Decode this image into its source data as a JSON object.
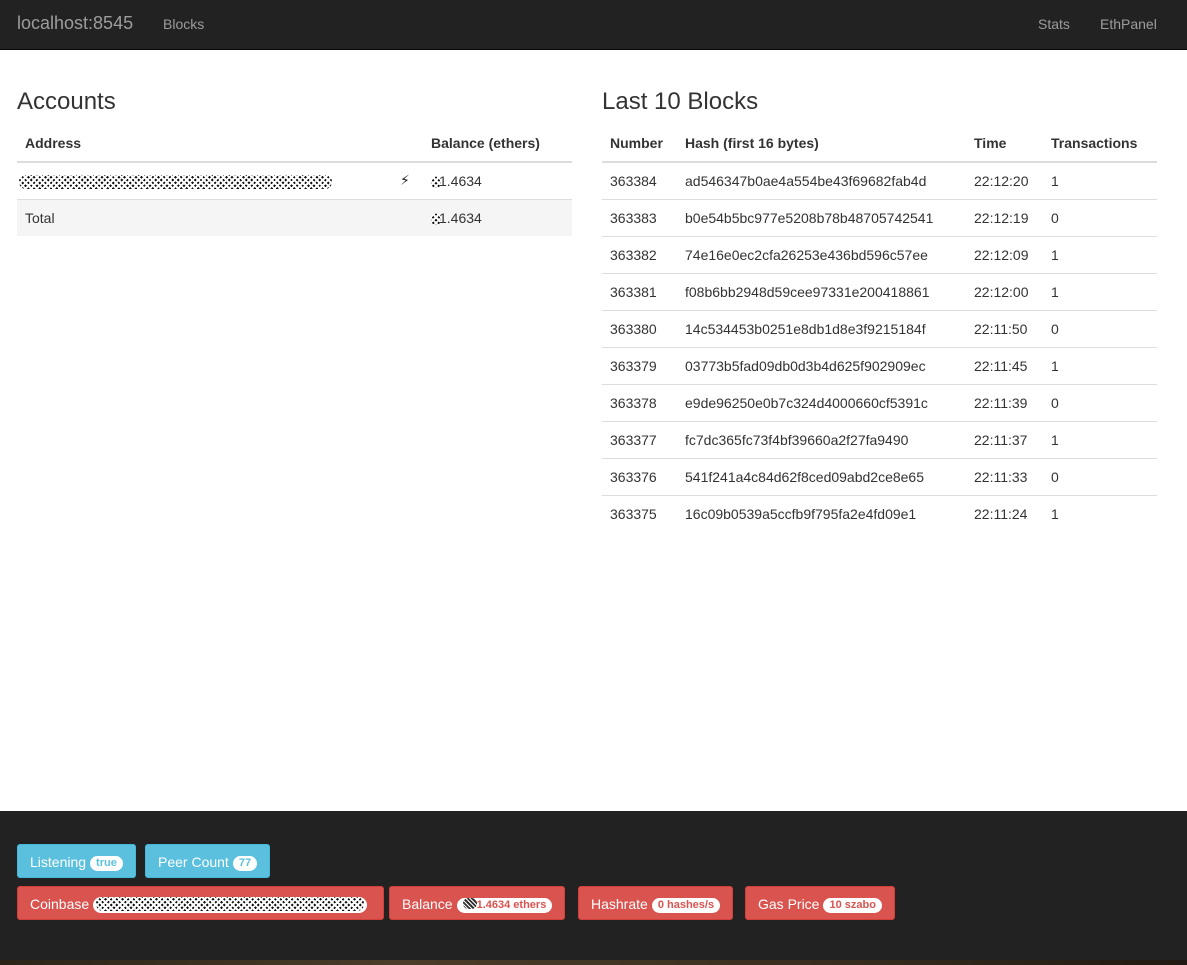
{
  "navbar": {
    "brand": "localhost:8545",
    "links": {
      "blocks": "Blocks",
      "stats": "Stats",
      "ethpanel": "EthPanel"
    }
  },
  "accounts": {
    "title": "Accounts",
    "headers": {
      "address": "Address",
      "balance": "Balance (ethers)"
    },
    "rows": [
      {
        "address": "[redacted]",
        "icon": "bolt-icon",
        "balance": "1.4634"
      }
    ],
    "total": {
      "label": "Total",
      "balance": "1.4634"
    }
  },
  "blocks": {
    "title": "Last 10 Blocks",
    "headers": {
      "number": "Number",
      "hash": "Hash (first 16 bytes)",
      "time": "Time",
      "transactions": "Transactions"
    },
    "rows": [
      {
        "number": "363384",
        "hash": "ad546347b0ae4a554be43f69682fab4d",
        "time": "22:12:20",
        "transactions": "1"
      },
      {
        "number": "363383",
        "hash": "b0e54b5bc977e5208b78b48705742541",
        "time": "22:12:19",
        "transactions": "0"
      },
      {
        "number": "363382",
        "hash": "74e16e0ec2cfa26253e436bd596c57ee",
        "time": "22:12:09",
        "transactions": "1"
      },
      {
        "number": "363381",
        "hash": "f08b6bb2948d59cee97331e200418861",
        "time": "22:12:00",
        "transactions": "1"
      },
      {
        "number": "363380",
        "hash": "14c534453b0251e8db1d8e3f9215184f",
        "time": "22:11:50",
        "transactions": "0"
      },
      {
        "number": "363379",
        "hash": "03773b5fad09db0d3b4d625f902909ec",
        "time": "22:11:45",
        "transactions": "1"
      },
      {
        "number": "363378",
        "hash": "e9de96250e0b7c324d4000660cf5391c",
        "time": "22:11:39",
        "transactions": "0"
      },
      {
        "number": "363377",
        "hash": "fc7dc365fc73f4bf39660a2f27fa9490",
        "time": "22:11:37",
        "transactions": "1"
      },
      {
        "number": "363376",
        "hash": "541f241a4c84d62f8ced09abd2ce8e65",
        "time": "22:11:33",
        "transactions": "0"
      },
      {
        "number": "363375",
        "hash": "16c09b0539a5ccfb9f795fa2e4fd09e1",
        "time": "22:11:24",
        "transactions": "1"
      }
    ]
  },
  "status": {
    "listening": {
      "label": "Listening",
      "value": "true"
    },
    "peer_count": {
      "label": "Peer Count",
      "value": "77"
    },
    "coinbase": {
      "label": "Coinbase",
      "value": "[redacted]"
    },
    "balance": {
      "label": "Balance",
      "value": "1.4634 ethers"
    },
    "hashrate": {
      "label": "Hashrate",
      "value": "0 hashes/s"
    },
    "gas_price": {
      "label": "Gas Price",
      "value": "10 szabo"
    }
  },
  "colors": {
    "navbar": "#222222",
    "info": "#5bc0de",
    "danger": "#d9534f"
  }
}
